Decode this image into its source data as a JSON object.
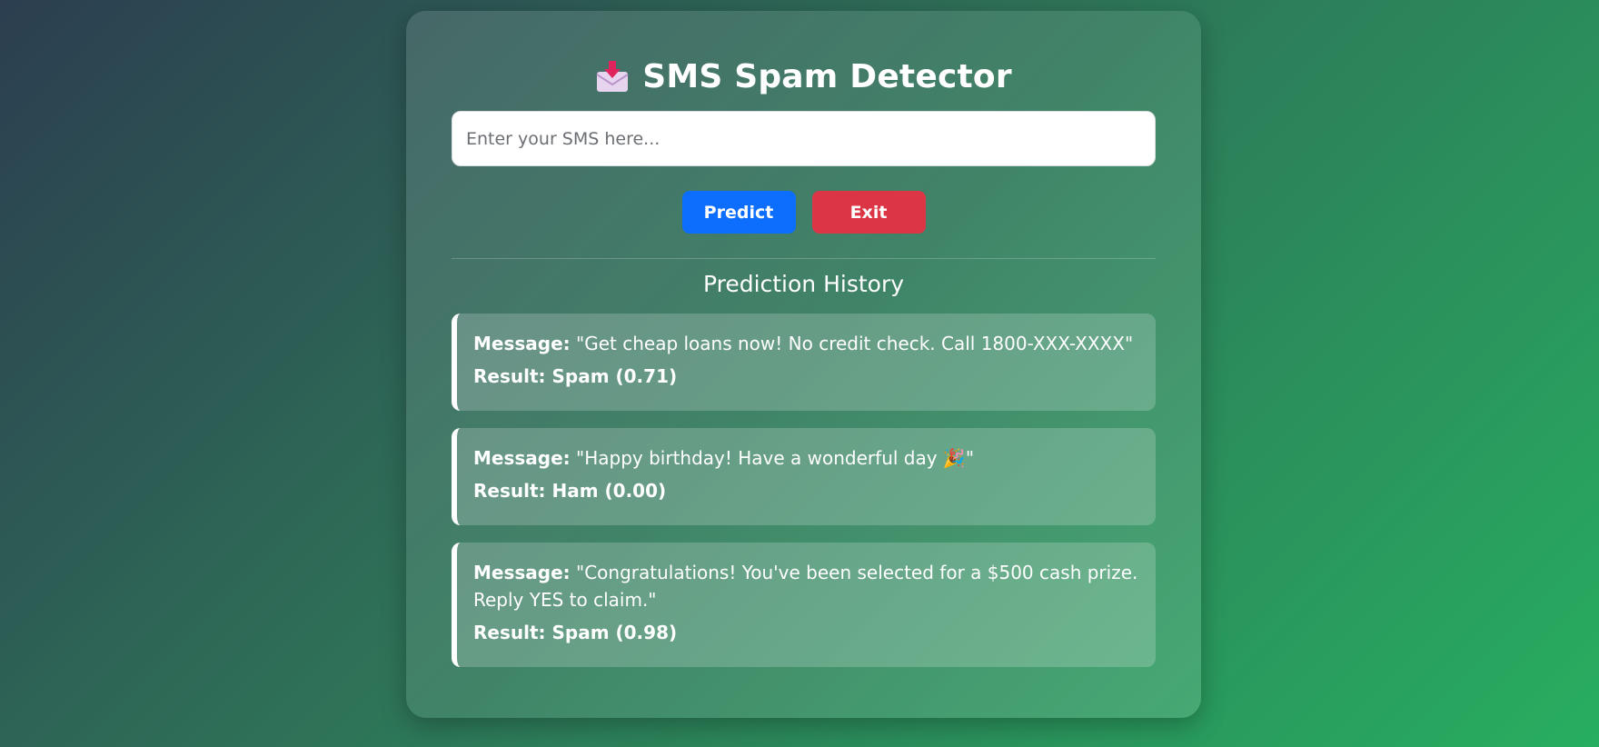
{
  "app": {
    "title": "SMS Spam Detector",
    "title_icon": "inbox-tray-icon"
  },
  "input": {
    "placeholder": "Enter your SMS here...",
    "value": ""
  },
  "buttons": {
    "predict_label": "Predict",
    "exit_label": "Exit"
  },
  "history": {
    "heading": "Prediction History",
    "message_label": "Message:",
    "items": [
      {
        "message": "\"Get cheap loans now! No credit check. Call 1800-XXX-XXXX\"",
        "result": "Result: Spam (0.71)"
      },
      {
        "message": "\"Happy birthday! Have a wonderful day 🎉\"",
        "result": "Result: Ham (0.00)"
      },
      {
        "message": "\"Congratulations! You've been selected for a $500 cash prize. Reply YES to claim.\"",
        "result": "Result: Spam (0.98)"
      }
    ]
  },
  "colors": {
    "predict_button": "#0d6efd",
    "exit_button": "#dc3545",
    "background_start": "#2c3e50",
    "background_end": "#27ae60"
  }
}
